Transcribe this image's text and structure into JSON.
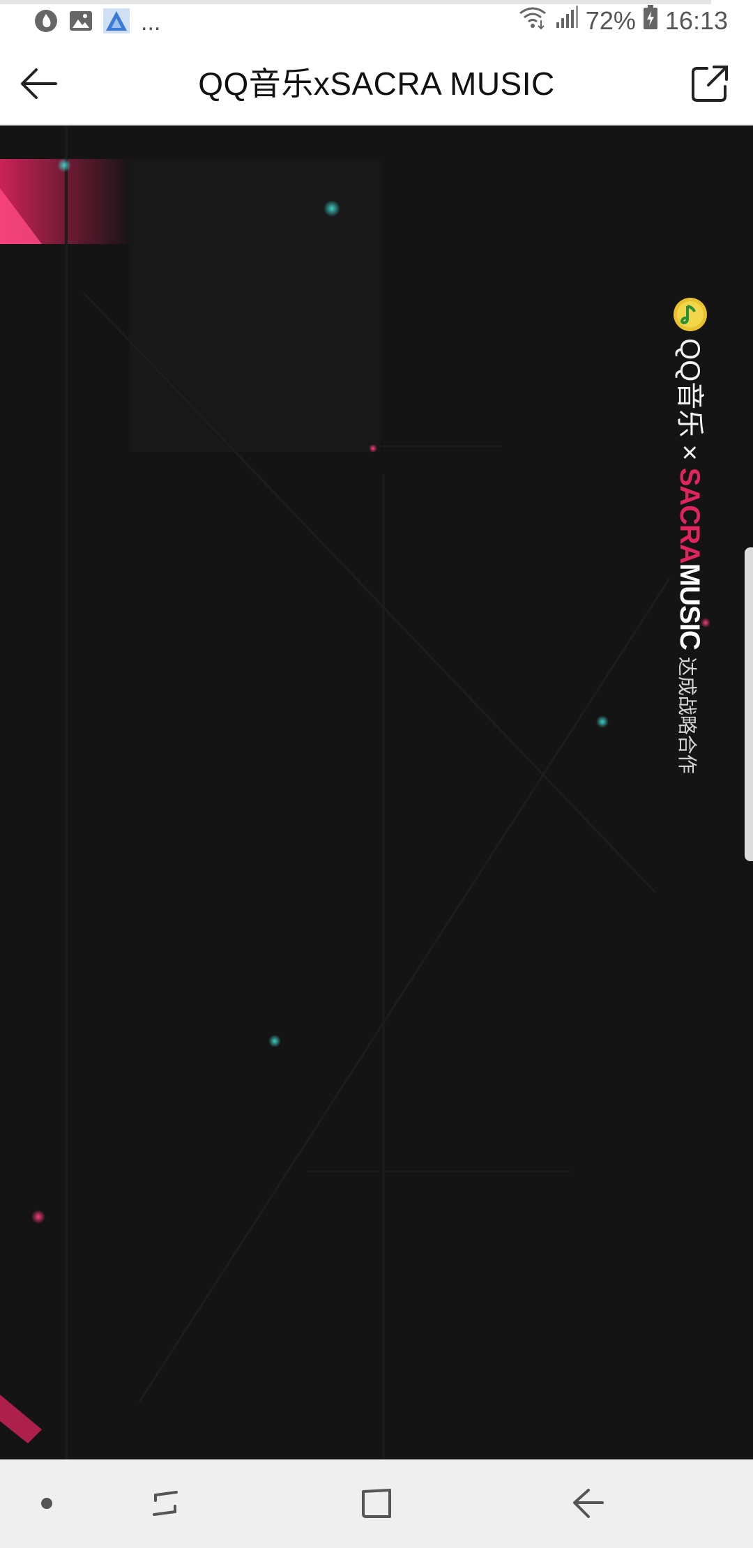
{
  "status_bar": {
    "battery": "72%",
    "time": "16:13",
    "more_indicator": "...",
    "icons": [
      "notification-icon",
      "image-icon",
      "app-icon",
      "wifi-icon",
      "signal-icon",
      "battery-icon"
    ]
  },
  "app_bar": {
    "title": "QQ音乐xSACRA MUSIC",
    "back_icon": "arrow-left-icon",
    "share_icon": "external-share-icon"
  },
  "banner": {
    "brand": "QQ音乐",
    "times": "×",
    "partner_sacra": "SACRA",
    "partner_music": "MUSIC",
    "subtitle": "达成战略合作",
    "colors": {
      "pink": "#e0245e",
      "teal": "#2bb5b0",
      "background": "#141414"
    }
  },
  "nav_bar": {
    "icons": [
      "dot-icon",
      "recent-apps-icon",
      "home-icon",
      "back-icon"
    ]
  }
}
